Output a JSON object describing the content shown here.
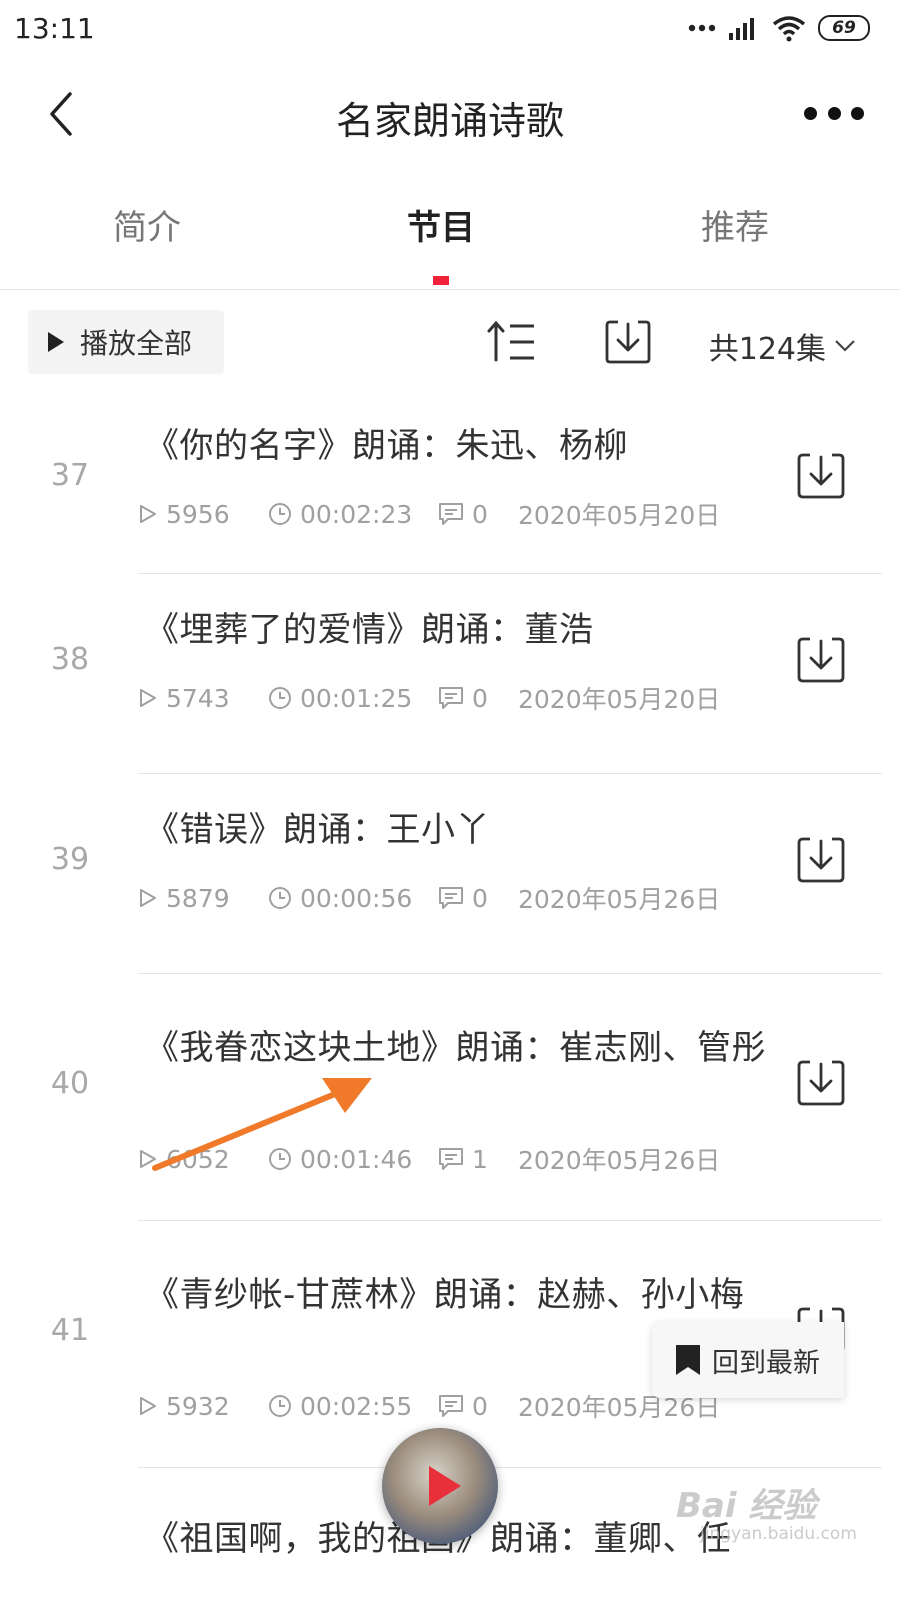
{
  "status": {
    "time": "13:11",
    "battery": "69"
  },
  "nav": {
    "title": "名家朗诵诗歌"
  },
  "tabs": [
    {
      "label": "简介"
    },
    {
      "label": "节目"
    },
    {
      "label": "推荐"
    }
  ],
  "toolbar": {
    "play_all": "播放全部",
    "episode_count": "共124集"
  },
  "episodes": [
    {
      "num": "37",
      "title": "《你的名字》朗诵：朱迅、杨柳",
      "plays": "5956",
      "duration": "00:02:23",
      "comments": "0",
      "date": "2020年05月20日"
    },
    {
      "num": "38",
      "title": "《埋葬了的爱情》朗诵：董浩",
      "plays": "5743",
      "duration": "00:01:25",
      "comments": "0",
      "date": "2020年05月20日"
    },
    {
      "num": "39",
      "title": "《错误》朗诵：王小丫",
      "plays": "5879",
      "duration": "00:00:56",
      "comments": "0",
      "date": "2020年05月26日"
    },
    {
      "num": "40",
      "title": "《我眷恋这块土地》朗诵：崔志刚、管彤",
      "plays": "6052",
      "duration": "00:01:46",
      "comments": "1",
      "date": "2020年05月26日"
    },
    {
      "num": "41",
      "title": "《青纱帐-甘蔗林》朗诵：赵赫、孙小梅",
      "plays": "5932",
      "duration": "00:02:55",
      "comments": "0",
      "date": "2020年05月26日"
    },
    {
      "num": "",
      "title": "《祖国啊，我的祖国》朗诵：董卿、任",
      "plays": "",
      "duration": "",
      "comments": "",
      "date": ""
    }
  ],
  "back_latest": {
    "label": "回到最新"
  },
  "watermark": {
    "main": "Bai 经验",
    "sub": "jingyan.baidu.com"
  },
  "colors": {
    "accent": "#f0233a",
    "annotation_arrow": "#f07a2a"
  }
}
